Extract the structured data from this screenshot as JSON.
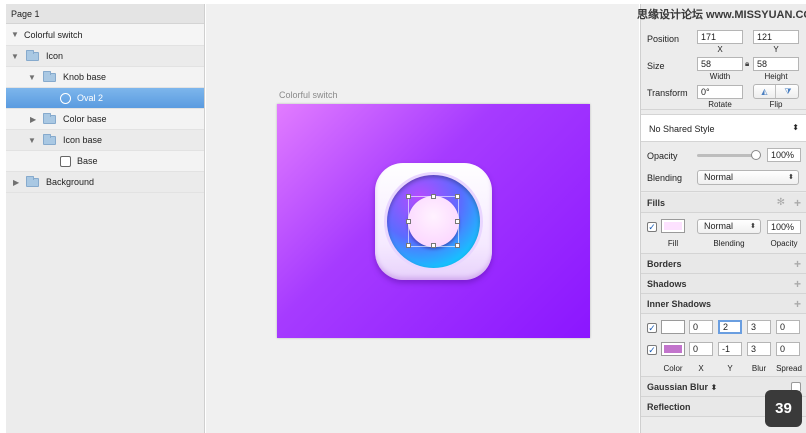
{
  "watermark": "思缘设计论坛 www.MISSYUAN.COM",
  "badge": "39",
  "layers": {
    "page": "Page 1",
    "items": [
      {
        "label": "Colorful switch"
      },
      {
        "label": "Icon"
      },
      {
        "label": "Knob base"
      },
      {
        "label": "Oval 2"
      },
      {
        "label": "Color base"
      },
      {
        "label": "Icon base"
      },
      {
        "label": "Base"
      },
      {
        "label": "Background"
      }
    ]
  },
  "canvas": {
    "artboard_title": "Colorful switch",
    "colors": {
      "bg_start": "#e27cff",
      "bg_end": "#8b16ff"
    }
  },
  "inspector": {
    "position": {
      "label": "Position",
      "x": "171",
      "y": "121",
      "x_cap": "X",
      "y_cap": "Y"
    },
    "size": {
      "label": "Size",
      "width": "58",
      "height": "58",
      "w_cap": "Width",
      "h_cap": "Height"
    },
    "transform": {
      "label": "Transform",
      "rotate": "0°",
      "rotate_cap": "Rotate",
      "flip_cap": "Flip"
    },
    "shared_style": "No Shared Style",
    "opacity": {
      "label": "Opacity",
      "value": "100%",
      "level": 1.0
    },
    "blending": {
      "label": "Blending",
      "value": "Normal"
    },
    "fills": {
      "header": "Fills",
      "blending": "Normal",
      "opacity": "100%",
      "caps": {
        "fill": "Fill",
        "blending": "Blending",
        "opacity": "Opacity"
      },
      "color": "#fde2ff"
    },
    "borders": "Borders",
    "shadows": "Shadows",
    "inner_shadows": {
      "header": "Inner Shadows",
      "rows": [
        {
          "color": "#ffffff",
          "x": "0",
          "y": "2",
          "blur": "3",
          "spread": "0"
        },
        {
          "color": "#c274cc",
          "x": "0",
          "y": "-1",
          "blur": "3",
          "spread": "0"
        }
      ],
      "caps": {
        "color": "Color",
        "x": "X",
        "y": "Y",
        "blur": "Blur",
        "spread": "Spread"
      }
    },
    "gaussian_blur": "Gaussian Blur",
    "reflection": "Reflection"
  }
}
